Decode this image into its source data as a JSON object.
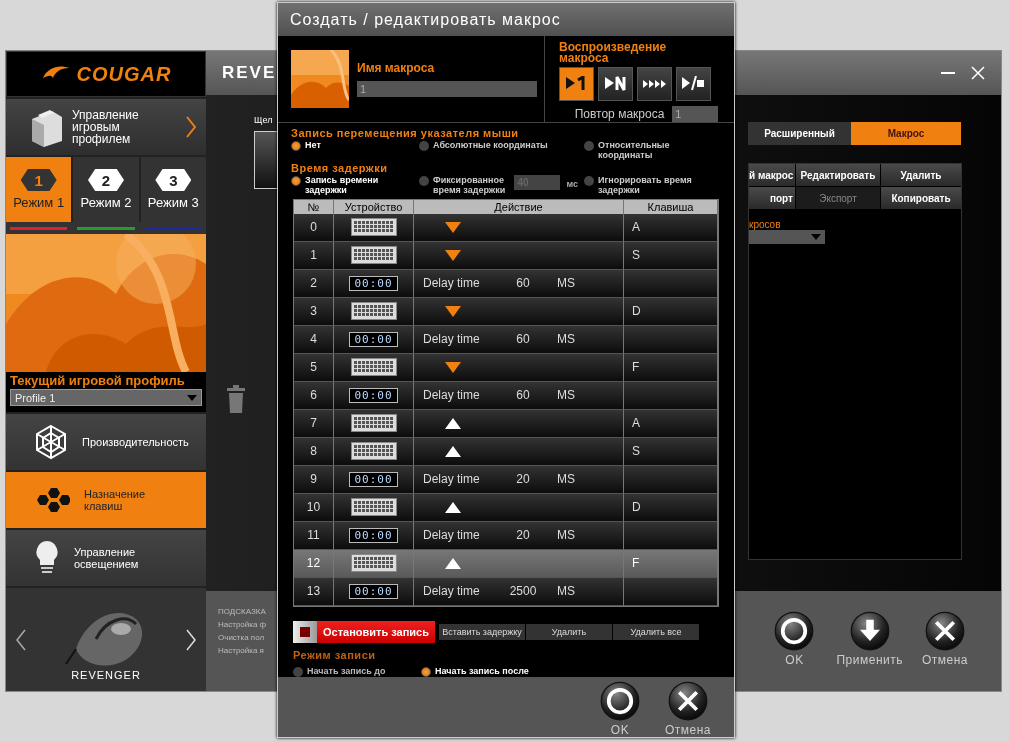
{
  "app": {
    "logo": "COUGAR",
    "title": "REVE",
    "profile_button": "Управление игровым профилем",
    "modes": [
      {
        "badge": "1",
        "label": "Режим 1",
        "selected": true,
        "color": "#e02030"
      },
      {
        "badge": "2",
        "label": "Режим 2",
        "selected": false,
        "color": "#2a9a30"
      },
      {
        "badge": "3",
        "label": "Режим 3",
        "selected": false,
        "color": "#1a28a8"
      }
    ],
    "current_profile_label": "Текущий игровой профиль",
    "profile_dropdown": {
      "value": "Profile 1"
    },
    "nav": [
      {
        "kind": "performance",
        "label": "Производительность",
        "selected": false
      },
      {
        "kind": "keys",
        "label": "Назначение клавиш",
        "selected": true
      },
      {
        "kind": "lighting",
        "label": "Управление освещением",
        "selected": false
      }
    ],
    "device_name": "REVENGER",
    "click_label": "Щел",
    "tabs": [
      {
        "label": "Расширенный",
        "selected": false
      },
      {
        "label": "Макрос",
        "selected": true
      }
    ],
    "macro_actions": [
      {
        "label": "й макрос",
        "disabled": false
      },
      {
        "label": "Редактировать",
        "disabled": false
      },
      {
        "label": "Удалить",
        "disabled": false
      },
      {
        "label": "порт",
        "disabled": false
      },
      {
        "label": "Экспорт",
        "disabled": true
      },
      {
        "label": "Копировать",
        "disabled": false
      }
    ],
    "macro_list_label": "кросов",
    "hint": {
      "title": "ПОДСКАЗКА",
      "lines": [
        "Настройка ф",
        "Очистка пол",
        "Настройка я"
      ]
    },
    "footer_buttons": [
      {
        "kind": "ok",
        "label": "OK"
      },
      {
        "kind": "apply",
        "label": "Применить"
      },
      {
        "kind": "cancel",
        "label": "Отмена"
      }
    ]
  },
  "dialog": {
    "title": "Создать / редактировать макрос",
    "macro_name": {
      "label": "Имя макроса",
      "value": "1"
    },
    "playback": {
      "label": "Воспроизведение макроса",
      "modes": [
        {
          "kind": "once",
          "selected": true
        },
        {
          "kind": "n_times",
          "selected": false
        },
        {
          "kind": "repeat",
          "selected": false
        },
        {
          "kind": "toggle",
          "selected": false
        }
      ],
      "repeat_label": "Повтор макроса",
      "repeat_value": "1"
    },
    "mouse_recording": {
      "label": "Запись перемещения указателя мыши",
      "options": [
        {
          "label": "Нет",
          "selected": true
        },
        {
          "label": "Абсолютные координаты",
          "selected": false
        },
        {
          "label": "Относительные координаты",
          "selected": false
        }
      ]
    },
    "delay": {
      "label": "Время задержки",
      "options": [
        {
          "label": "Запись времени задержки",
          "selected": true
        },
        {
          "label": "Фиксированное время задержки",
          "selected": false
        },
        {
          "label": "Игнорировать время задержки",
          "selected": false
        }
      ],
      "fixed_value": "40",
      "unit": "мс"
    },
    "table": {
      "columns": [
        "№",
        "Устройство",
        "Действие",
        "Клавиша"
      ],
      "rows": [
        {
          "no": "0",
          "kind": "key_down",
          "key": "A",
          "selected": false
        },
        {
          "no": "1",
          "kind": "key_down",
          "key": "S",
          "selected": false
        },
        {
          "no": "2",
          "kind": "delay",
          "device": "00:00",
          "label": "Delay time",
          "value": "60",
          "unit": "MS",
          "selected": false
        },
        {
          "no": "3",
          "kind": "key_down",
          "key": "D",
          "selected": false
        },
        {
          "no": "4",
          "kind": "delay",
          "device": "00:00",
          "label": "Delay time",
          "value": "60",
          "unit": "MS",
          "selected": false
        },
        {
          "no": "5",
          "kind": "key_down",
          "key": "F",
          "selected": false
        },
        {
          "no": "6",
          "kind": "delay",
          "device": "00:00",
          "label": "Delay time",
          "value": "60",
          "unit": "MS",
          "selected": false
        },
        {
          "no": "7",
          "kind": "key_up",
          "key": "A",
          "selected": false
        },
        {
          "no": "8",
          "kind": "key_up",
          "key": "S",
          "selected": false
        },
        {
          "no": "9",
          "kind": "delay",
          "device": "00:00",
          "label": "Delay time",
          "value": "20",
          "unit": "MS",
          "selected": false
        },
        {
          "no": "10",
          "kind": "key_up",
          "key": "D",
          "selected": false
        },
        {
          "no": "11",
          "kind": "delay",
          "device": "00:00",
          "label": "Delay time",
          "value": "20",
          "unit": "MS",
          "selected": false
        },
        {
          "no": "12",
          "kind": "key_up",
          "key": "F",
          "selected": true
        },
        {
          "no": "13",
          "kind": "delay",
          "device": "00:00",
          "label": "Delay time",
          "value": "2500",
          "unit": "MS",
          "selected": false
        }
      ]
    },
    "stop_button": "Остановить запись",
    "edit_buttons": [
      "Вставить задержку",
      "Удалить",
      "Удалить все"
    ],
    "record_mode": {
      "label": "Режим записи",
      "options": [
        {
          "label": "Начать запись до",
          "selected": false
        },
        {
          "label": "Начать запись после",
          "selected": true
        }
      ]
    },
    "footer_buttons": [
      {
        "kind": "ok",
        "label": "OK"
      },
      {
        "kind": "cancel",
        "label": "Отмена"
      }
    ]
  }
}
